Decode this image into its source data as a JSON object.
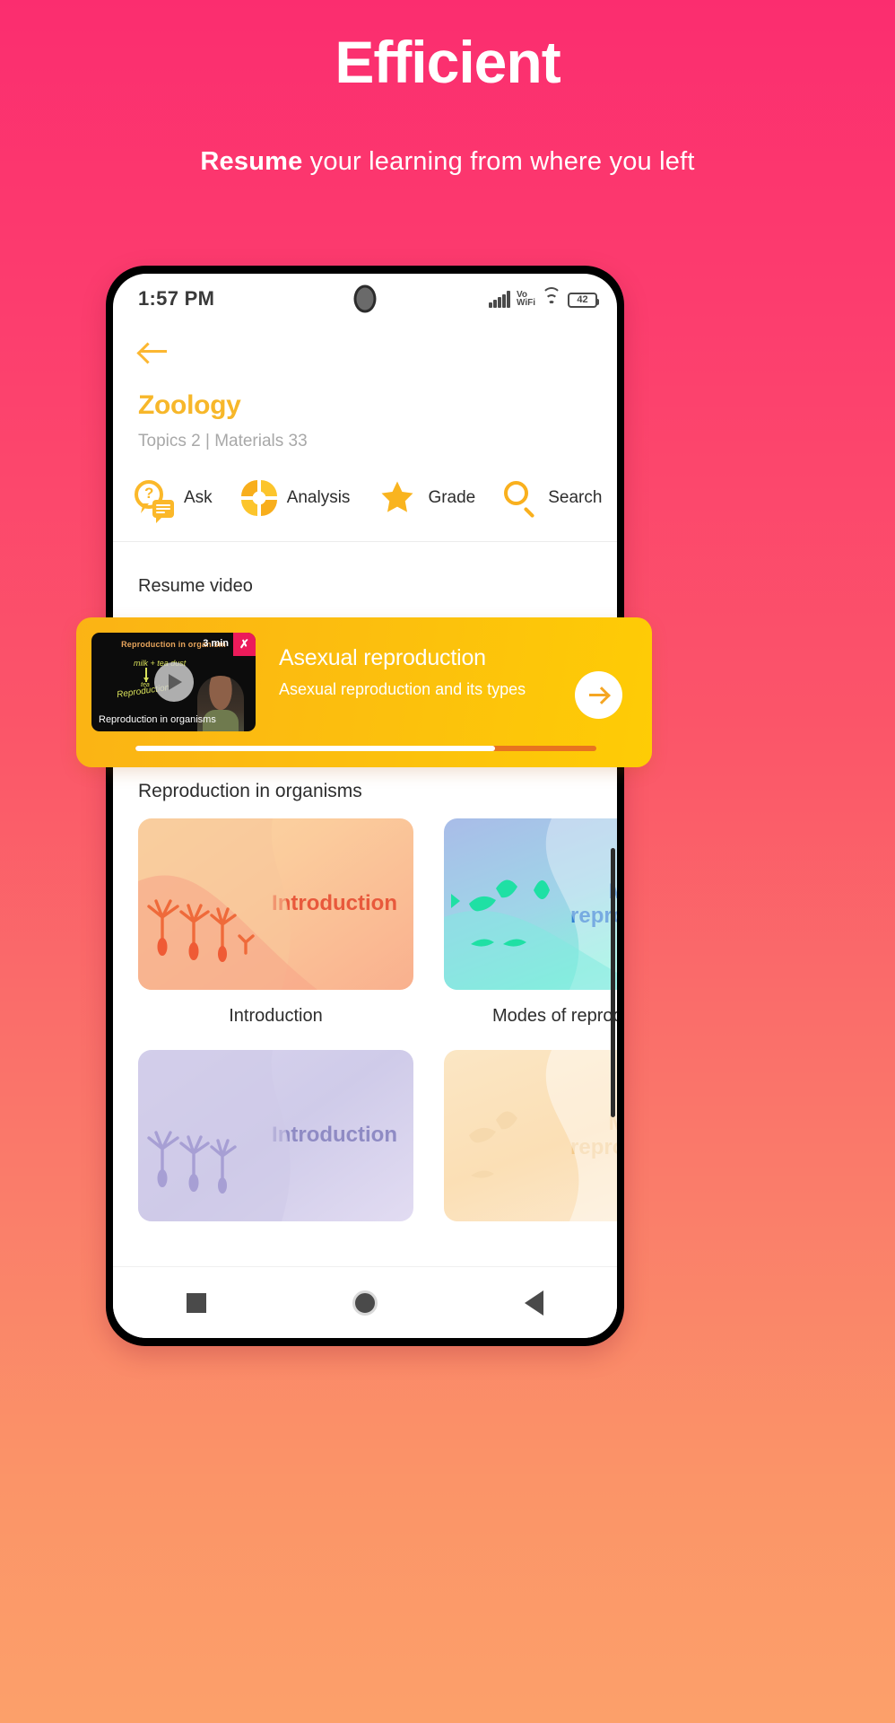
{
  "promo": {
    "title": "Efficient",
    "subtitle_bold": "Resume",
    "subtitle_rest": " your learning from where you left"
  },
  "status_bar": {
    "time": "1:57 PM",
    "network_label": "Vo",
    "network_label2": "WiFi",
    "battery": "42",
    "signal_icon": "signal-bars-icon",
    "wifi_icon": "wifi-icon",
    "battery_icon": "battery-icon",
    "camera_icon": "front-camera-punchhole"
  },
  "appbar": {
    "back_icon": "back-arrow-icon"
  },
  "subject": {
    "name": "Zoology",
    "meta": "Topics 2  |  Materials 33",
    "topics_count": "2",
    "materials_count": "33"
  },
  "actions": [
    {
      "label": "Ask",
      "icon": "ask-question-icon"
    },
    {
      "label": "Analysis",
      "icon": "pie-chart-icon"
    },
    {
      "label": "Grade",
      "icon": "star-icon"
    },
    {
      "label": "Search",
      "icon": "search-icon"
    }
  ],
  "resume": {
    "section_label": "Resume video",
    "title": "Asexual reproduction",
    "subtitle": "Asexual reproduction and its types",
    "go_icon": "arrow-right-icon",
    "progress_percent": 78,
    "thumbnail": {
      "heading": "Reproduction in organism",
      "note_top": "milk  +  tea dust",
      "note_side": "Reproduction",
      "note_small": "tea",
      "duration": "3 min",
      "caption": "Reproduction in organisms",
      "play_icon": "play-icon",
      "brand_icon": "brand-logo-icon"
    }
  },
  "topics": {
    "heading": "Reproduction in organisms",
    "items": [
      {
        "label": "Introduction",
        "caption": "Introduction",
        "theme": "t-intro"
      },
      {
        "label": "Modes of\nreproduction",
        "caption": "Modes of reproduction",
        "theme": "t-modes"
      },
      {
        "label": "Introduction",
        "caption": "",
        "theme": "t-intro2"
      },
      {
        "label": "Modes of\nreproduction",
        "caption": "",
        "theme": "t-modes2"
      }
    ]
  },
  "navbar": {
    "recent_icon": "recents-square-icon",
    "home_icon": "home-circle-icon",
    "back_icon": "back-triangle-icon"
  },
  "colors": {
    "bg_pink": "#fb2d6f",
    "bg_orange": "#fca06a",
    "accent_yellow": "#f7b72a",
    "card_yellow": "#fcc00d"
  }
}
